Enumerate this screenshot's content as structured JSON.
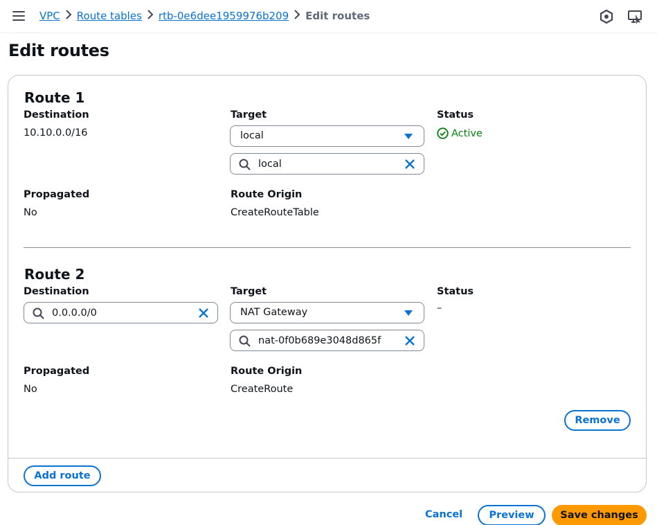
{
  "breadcrumbs": {
    "items": [
      "VPC",
      "Route tables",
      "rtb-0e6dee1959976b209"
    ],
    "current": "Edit routes",
    "separator": "›"
  },
  "page": {
    "title": "Edit routes"
  },
  "icons": {
    "menu": "hamburger-menu-icon",
    "notifications": "hexagon-notification-icon",
    "help": "screen-help-icon"
  },
  "labels": {
    "destination": "Destination",
    "target": "Target",
    "status": "Status",
    "propagated": "Propagated",
    "route_origin": "Route Origin"
  },
  "routes": [
    {
      "title": "Route 1",
      "destination": "10.10.0.0/16",
      "target_type": "local",
      "target_value": "local",
      "status": "Active",
      "propagated": "No",
      "route_origin": "CreateRouteTable"
    },
    {
      "title": "Route 2",
      "destination": "0.0.0.0/0",
      "target_type": "NAT Gateway",
      "target_value": "nat-0f0b689e3048d865f",
      "status": "–",
      "propagated": "No",
      "route_origin": "CreateRoute",
      "remove_label": "Remove"
    }
  ],
  "actions": {
    "add_route": "Add route",
    "cancel": "Cancel",
    "preview": "Preview",
    "save": "Save changes"
  },
  "colors": {
    "link": "#0972d3",
    "success": "#037f0c",
    "primary": "#ff9900"
  }
}
